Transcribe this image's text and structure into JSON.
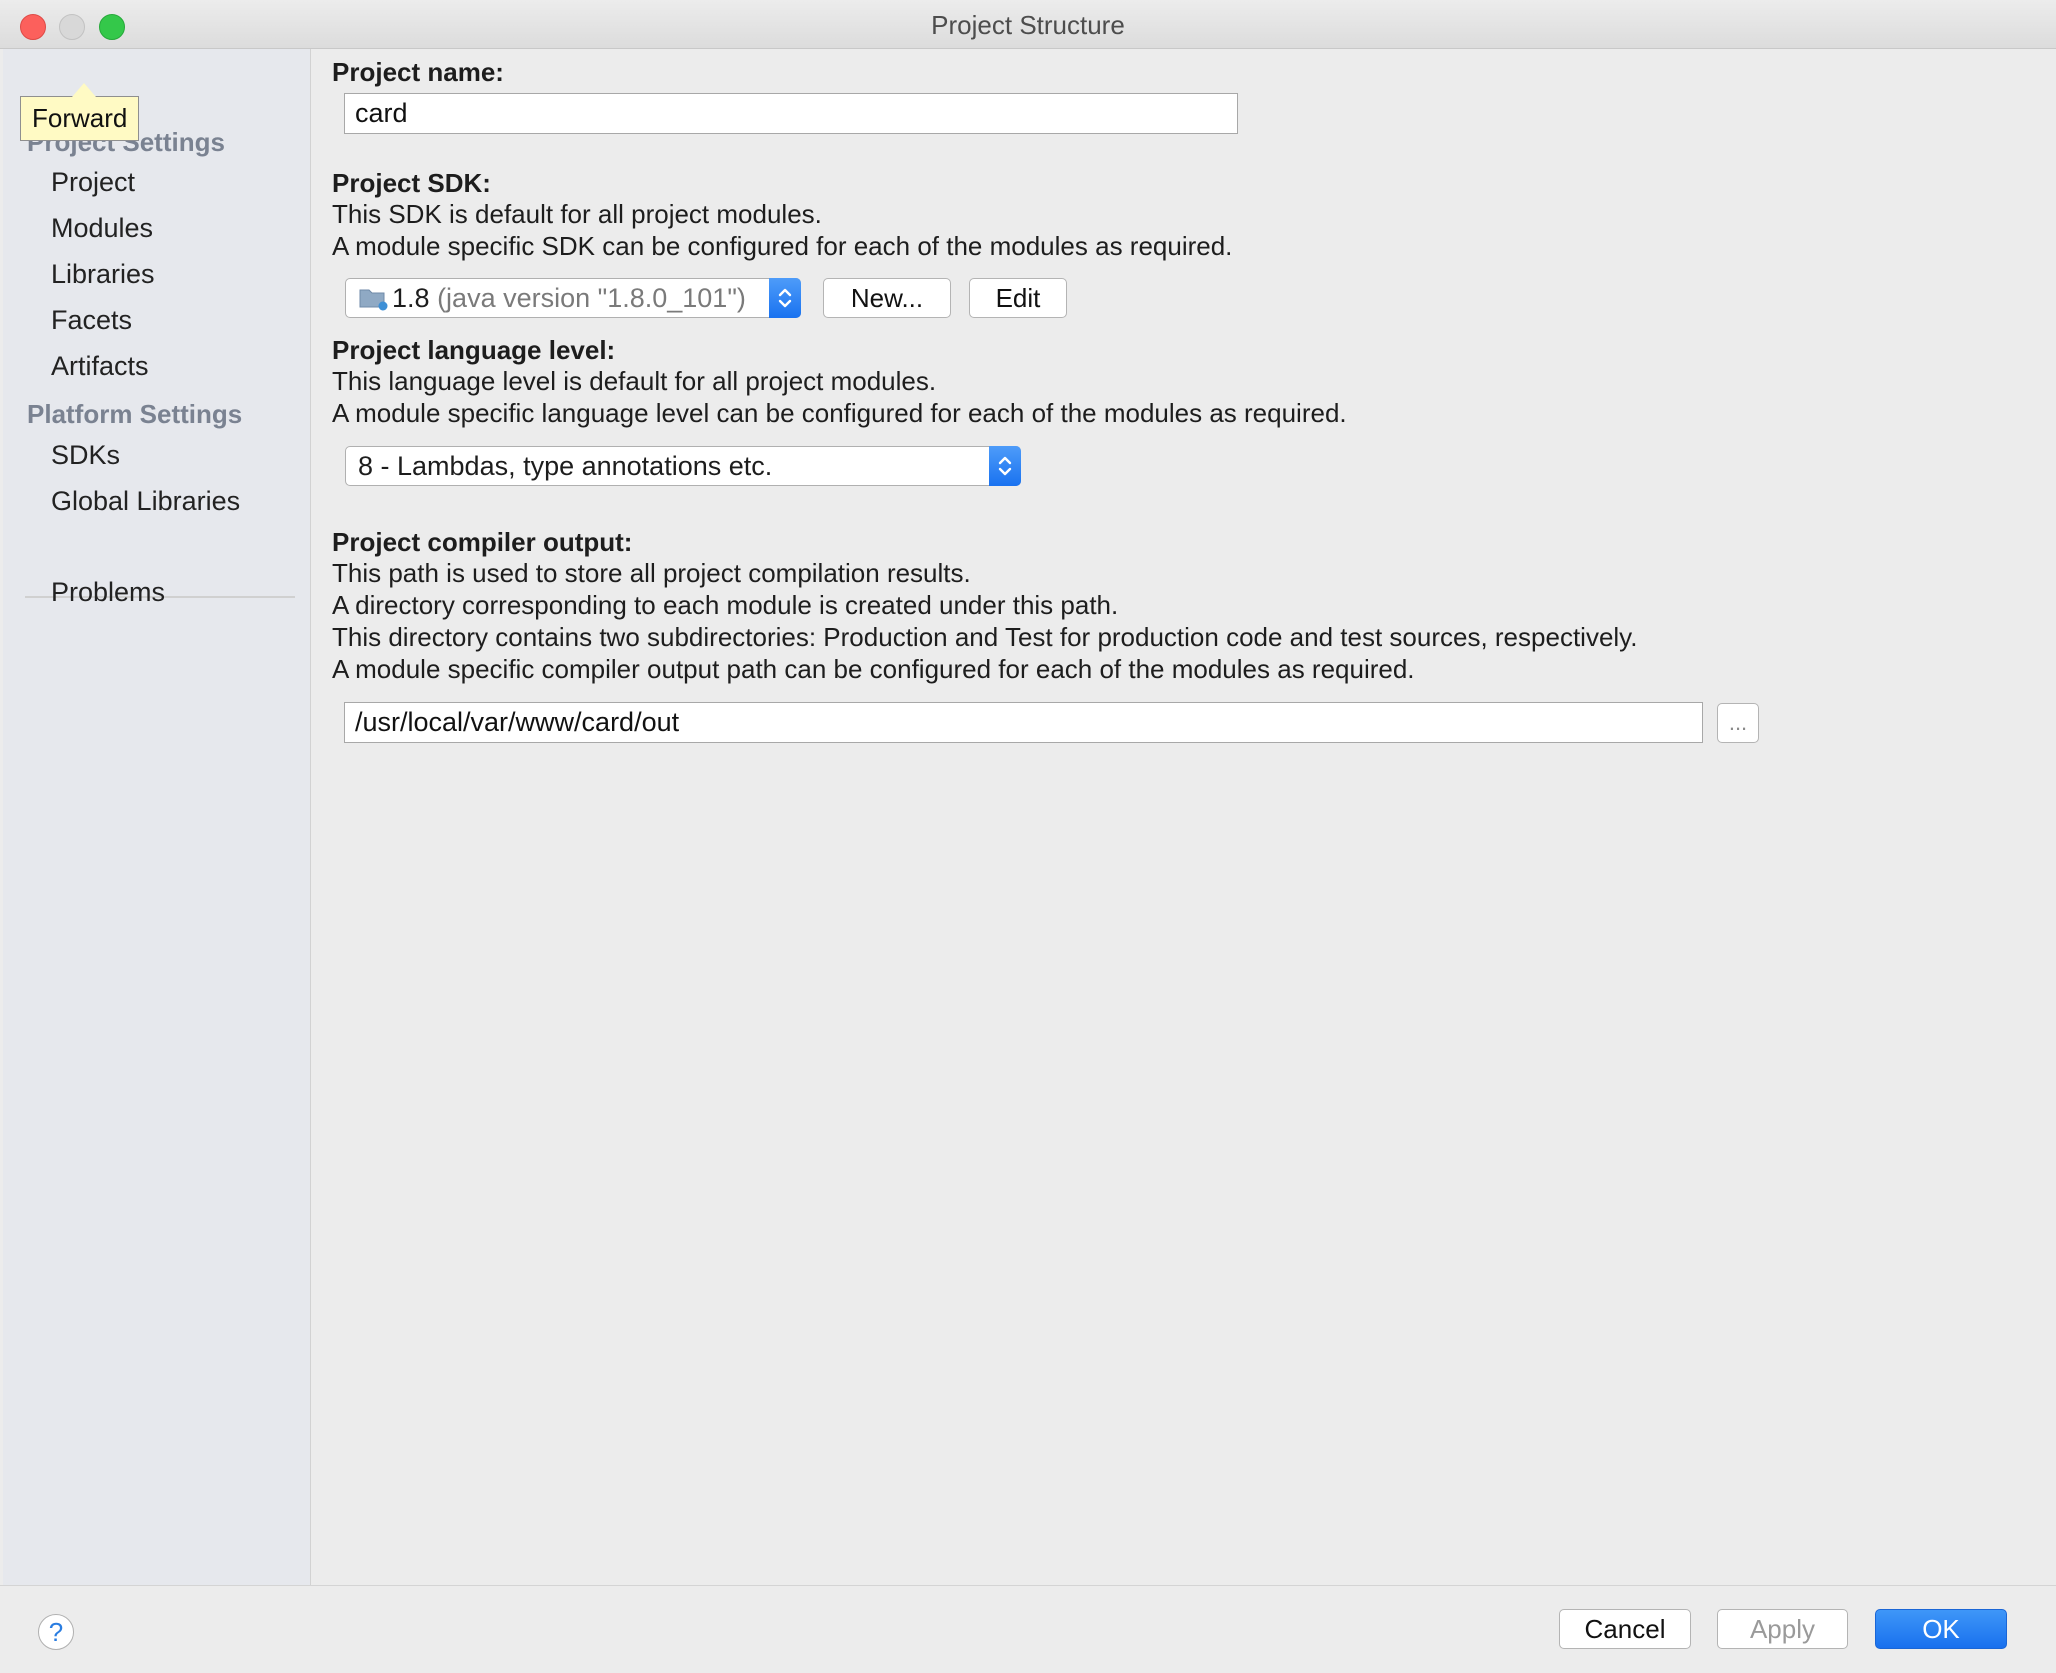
{
  "window": {
    "title": "Project Structure"
  },
  "nav": {
    "tooltip": "Forward"
  },
  "sidebar": {
    "project_settings_header": "Project Settings",
    "project_items": [
      "Project",
      "Modules",
      "Libraries",
      "Facets",
      "Artifacts"
    ],
    "platform_settings_header": "Platform Settings",
    "platform_items": [
      "SDKs",
      "Global Libraries"
    ],
    "problems": "Problems"
  },
  "project_name": {
    "label": "Project name:",
    "value": "card"
  },
  "sdk": {
    "label": "Project SDK:",
    "desc1": "This SDK is default for all project modules.",
    "desc2": "A module specific SDK can be configured for each of the modules as required.",
    "selected_version": "1.8",
    "selected_detail": "(java version \"1.8.0_101\")",
    "new_button": "New...",
    "edit_button": "Edit"
  },
  "language_level": {
    "label": "Project language level:",
    "desc1": "This language level is default for all project modules.",
    "desc2": "A module specific language level can be configured for each of the modules as required.",
    "selected": "8 - Lambdas, type annotations etc."
  },
  "compiler_output": {
    "label": "Project compiler output:",
    "desc1": "This path is used to store all project compilation results.",
    "desc2": "A directory corresponding to each module is created under this path.",
    "desc3": "This directory contains two subdirectories: Production and Test for production code and test sources, respectively.",
    "desc4": "A module specific compiler output path can be configured for each of the modules as required.",
    "path": "/usr/local/var/www/card/out",
    "browse_button": "..."
  },
  "footer": {
    "help": "?",
    "cancel": "Cancel",
    "apply": "Apply",
    "ok": "OK"
  },
  "colors": {
    "accent": "#1a73ef",
    "sidebar_bg": "#e6e8ed",
    "tooltip_bg": "#fffac4"
  }
}
